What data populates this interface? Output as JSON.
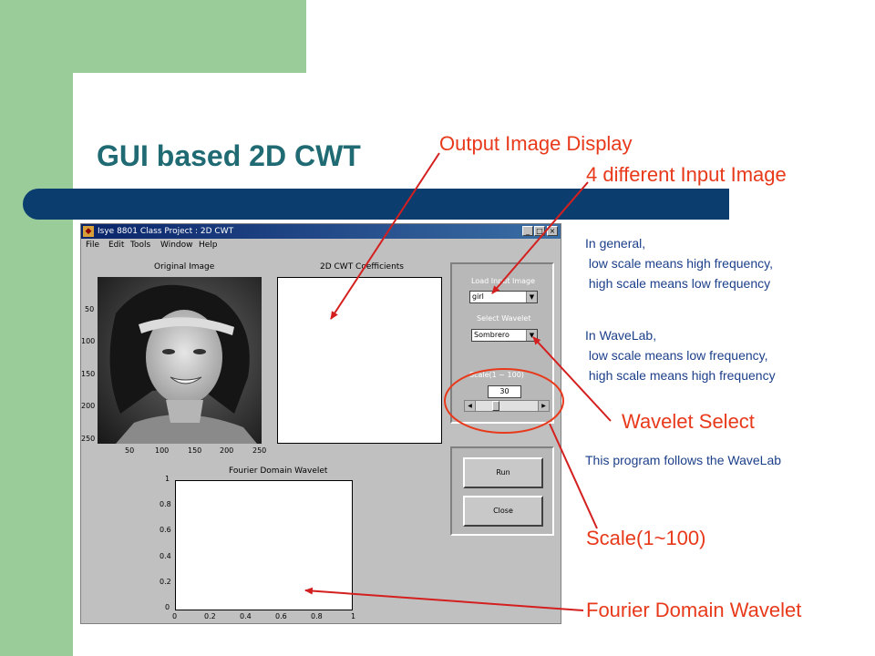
{
  "slide": {
    "title": "GUI based 2D CWT",
    "annotations": {
      "output_display": "Output Image Display",
      "input_image": "4 different Input Image",
      "wavelet_select": "Wavelet Select",
      "scale": "Scale(1~100)",
      "fourier": "Fourier Domain Wavelet"
    },
    "notes": {
      "general_1": "In general,",
      "general_2": " low scale means high frequency,",
      "general_3": " high scale means low frequency",
      "wavelab_1": "In WaveLab,",
      "wavelab_2": " low scale means low frequency,",
      "wavelab_3": " high scale means high frequency",
      "follows": "This program follows the WaveLab"
    },
    "colors": {
      "green": "#99cc99",
      "navy_bar": "#0b3d6e",
      "title": "#1f6a73",
      "annotation_red": "#e8391b",
      "note_blue": "#1c3f8a"
    }
  },
  "window": {
    "title": "Isye 8801 Class Project : 2D CWT",
    "menus": [
      "File",
      "Edit",
      "Tools",
      "Window",
      "Help"
    ],
    "original": {
      "title": "Original Image",
      "y_ticks": [
        "50",
        "100",
        "150",
        "200",
        "250"
      ],
      "x_ticks": [
        "50",
        "100",
        "150",
        "200",
        "250"
      ]
    },
    "cwt": {
      "title": "2D CWT Coefficients"
    },
    "fourier": {
      "title": "Fourier Domain Wavelet",
      "y_ticks": [
        "1",
        "0.8",
        "0.6",
        "0.4",
        "0.2",
        "0"
      ],
      "x_ticks": [
        "0",
        "0.2",
        "0.4",
        "0.6",
        "0.8",
        "1"
      ]
    },
    "controls": {
      "load_label": "Load Input Image",
      "load_value": "girl",
      "wavelet_label": "Select Wavelet",
      "wavelet_value": "Sombrero",
      "scale_label": "Scale(1 ~ 100)",
      "scale_value": "30",
      "scale_fraction": 0.3,
      "run_label": "Run",
      "close_label": "Close"
    }
  }
}
